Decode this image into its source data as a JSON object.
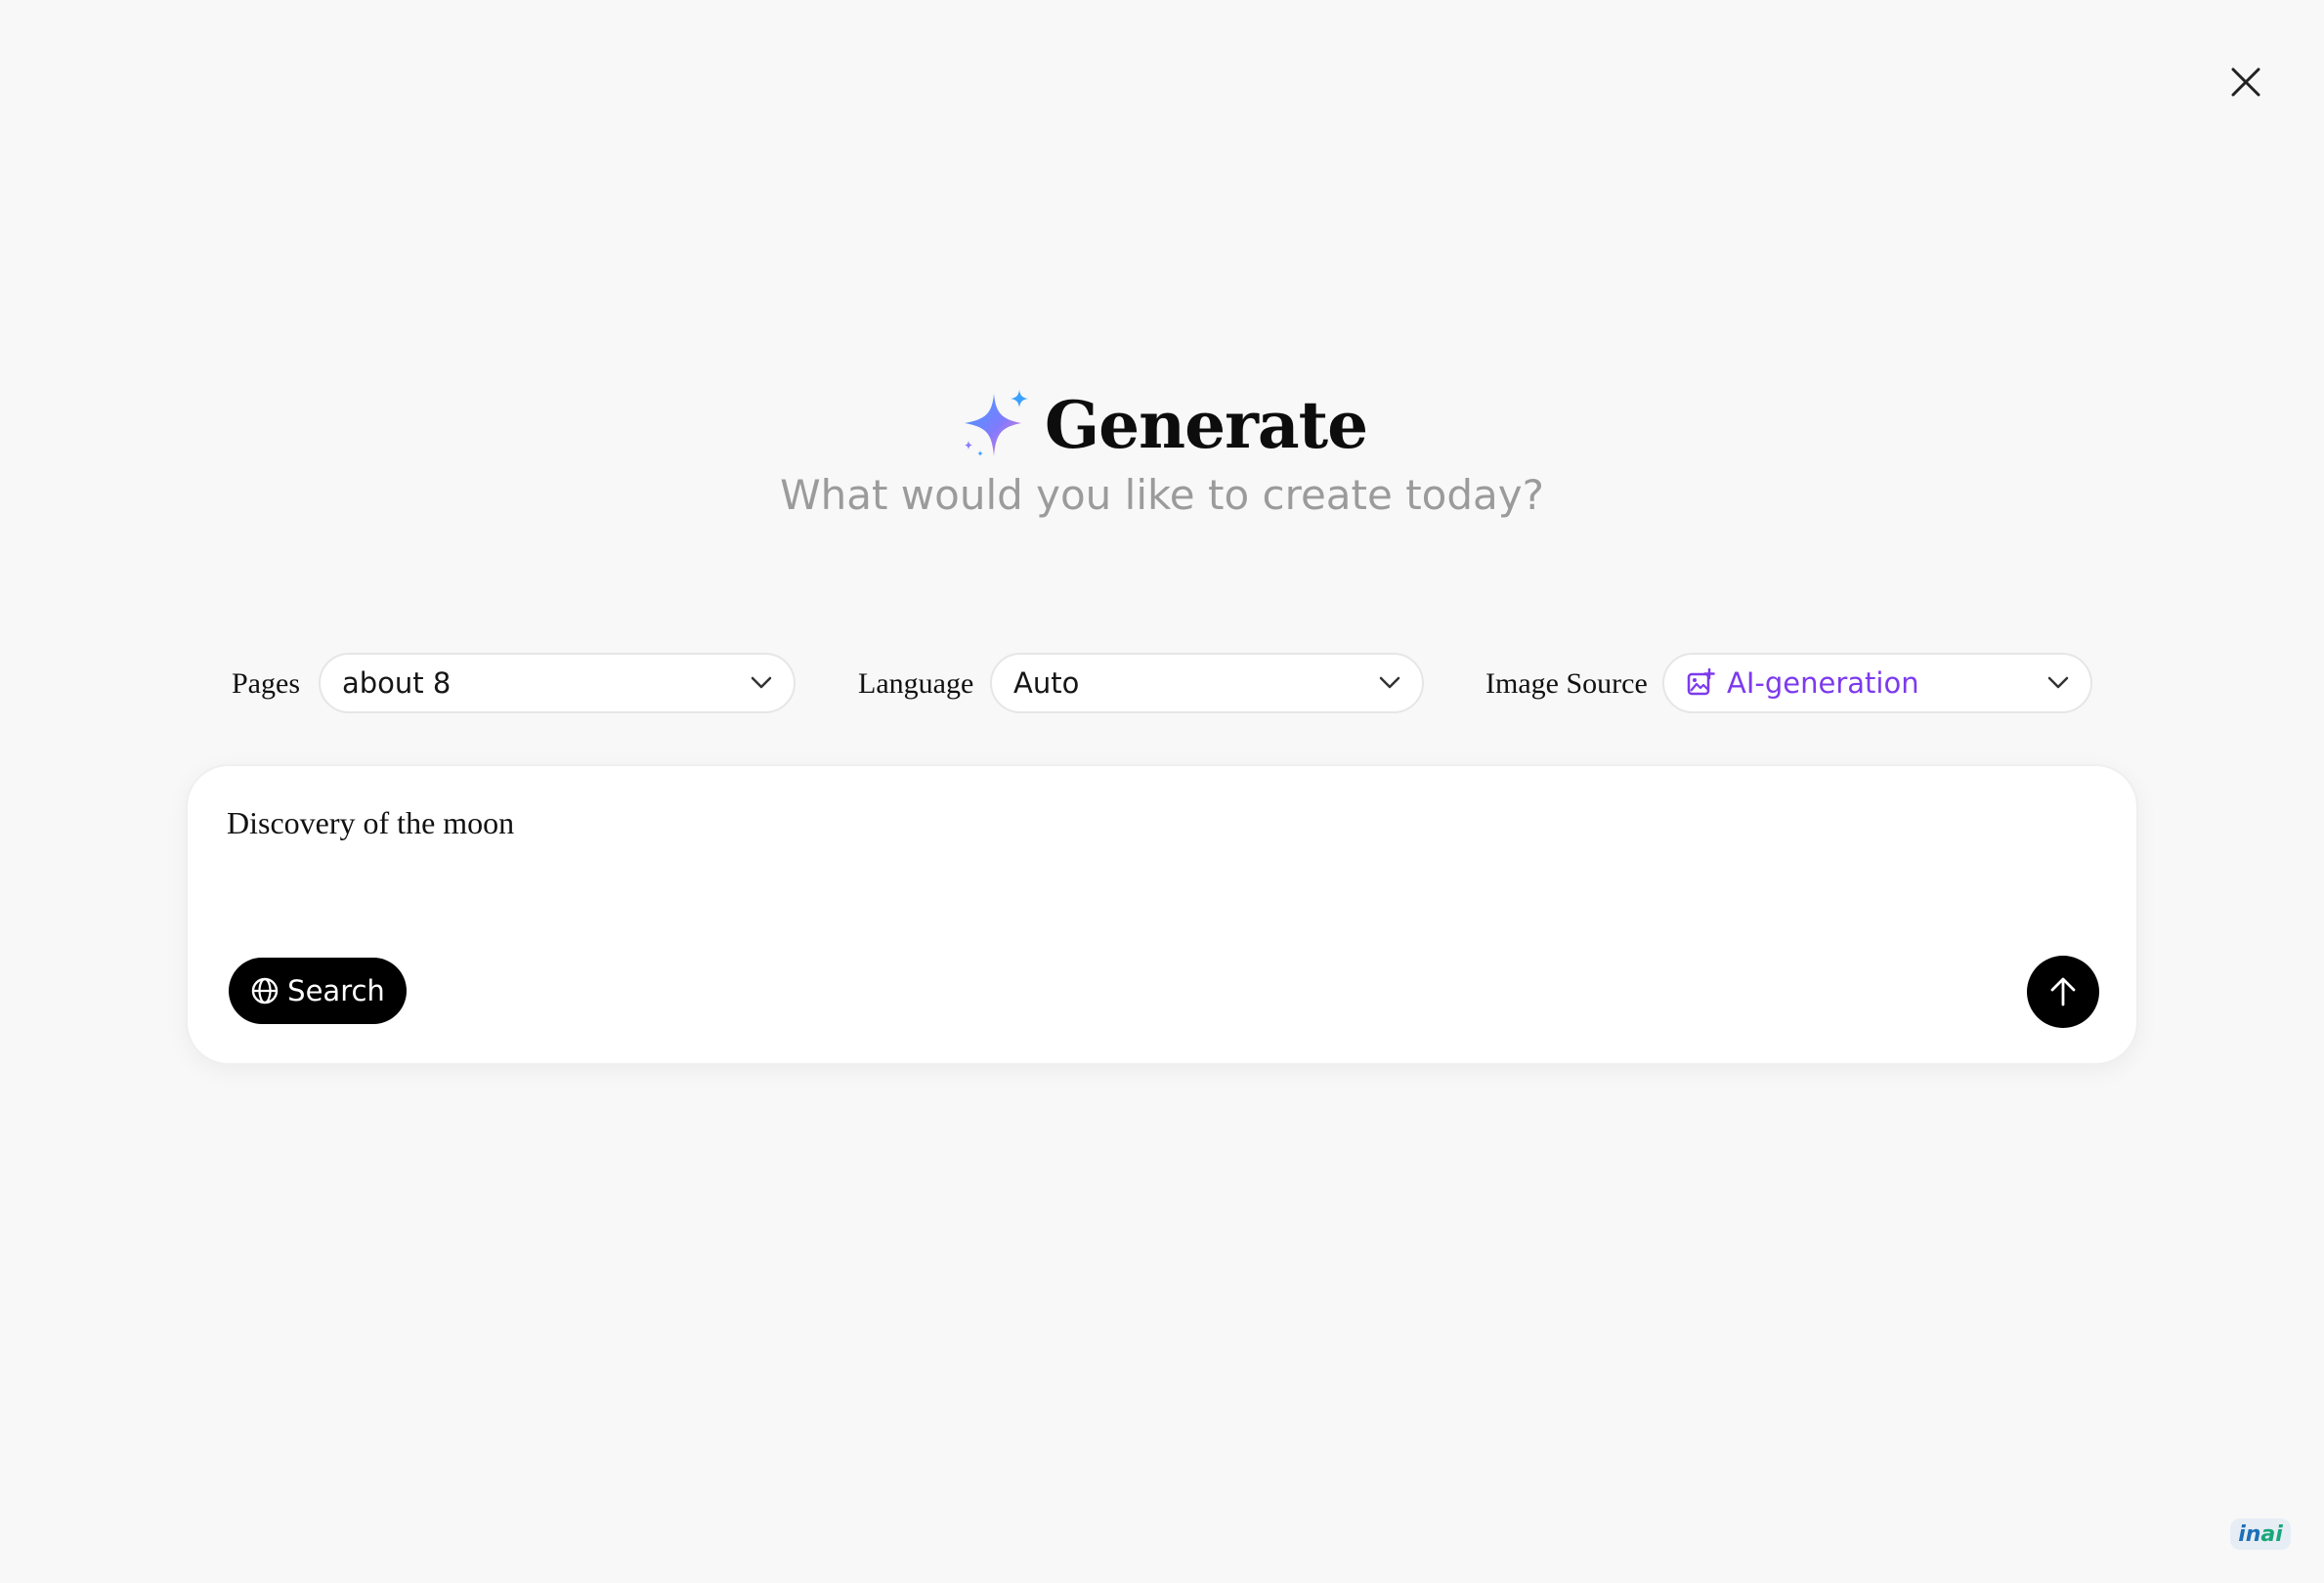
{
  "header": {
    "title": "Generate",
    "subtitle": "What would you like to create today?",
    "title_icon": "sparkle-icon"
  },
  "options": {
    "pages": {
      "label": "Pages",
      "value": "about 8"
    },
    "language": {
      "label": "Language",
      "value": "Auto"
    },
    "image_source": {
      "label": "Image Source",
      "value": "AI-generation",
      "icon": "image-plus-icon"
    }
  },
  "prompt": {
    "value": "Discovery of the moon",
    "search_label": "Search",
    "search_icon": "globe-icon",
    "send_icon": "arrow-up-icon"
  },
  "brand": {
    "part1": "in",
    "part2": "ai"
  },
  "colors": {
    "background": "#f8f8f8",
    "accent_purple": "#7c3aed",
    "button_black": "#000000",
    "subtitle_gray": "#9b9b9b"
  }
}
